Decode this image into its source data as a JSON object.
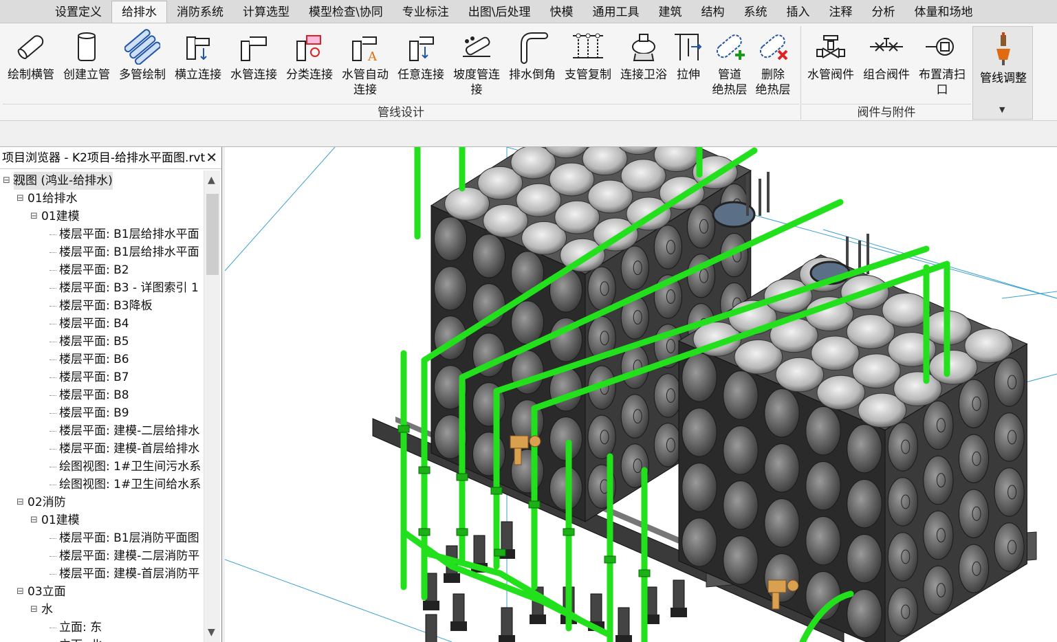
{
  "ribbon": {
    "tabs": [
      "设置定义",
      "给排水",
      "消防系统",
      "计算选型",
      "模型检查\\协同",
      "专业标注",
      "出图\\后处理",
      "快模",
      "通用工具",
      "建筑",
      "结构",
      "系统",
      "插入",
      "注释",
      "分析",
      "体量和场地"
    ],
    "active_tab": "给排水",
    "pipeline_design": {
      "title": "管线设计",
      "buttons": [
        {
          "label": "绘制横管",
          "icon": "horizontal-pipe-icon"
        },
        {
          "label": "创建立管",
          "icon": "vertical-pipe-icon"
        },
        {
          "label": "多管绘制",
          "icon": "multi-pipe-icon"
        },
        {
          "label": "横立连接",
          "icon": "horizontal-vertical-connect-icon"
        },
        {
          "label": "水管连接",
          "icon": "pipe-connect-icon"
        },
        {
          "label": "分类连接",
          "icon": "category-connect-icon"
        },
        {
          "label": "水管自动",
          "label2": "连接",
          "icon": "auto-connect-icon"
        },
        {
          "label": "任意连接",
          "icon": "any-connect-icon"
        },
        {
          "label": "坡度管连",
          "label2": "接",
          "icon": "slope-pipe-icon"
        },
        {
          "label": "排水倒角",
          "icon": "drain-chamfer-icon"
        },
        {
          "label": "支管复制",
          "icon": "branch-copy-icon"
        },
        {
          "label": "连接卫浴",
          "icon": "sanitary-connect-icon"
        },
        {
          "label": "拉伸",
          "icon": "stretch-icon"
        },
        {
          "label": "管道",
          "label2": "绝热层",
          "icon": "add-insulation-icon"
        },
        {
          "label": "删除",
          "label2": "绝热层",
          "icon": "delete-insulation-icon"
        }
      ]
    },
    "valves_accessories": {
      "title": "阀件与附件",
      "buttons": [
        {
          "label": "水管阀件",
          "icon": "valve-icon"
        },
        {
          "label": "组合阀件",
          "icon": "combined-valve-icon"
        },
        {
          "label": "布置清扫",
          "label2": "口",
          "icon": "cleanout-icon"
        }
      ]
    },
    "pipe_adjust": {
      "label": "管线调整",
      "icon": "pipe-adjust-icon"
    }
  },
  "browser": {
    "title": "项目浏览器 - K2项目-给排水平面图.rvt",
    "close_glyph": "✕",
    "tree": [
      {
        "text": "视图 (鸿业-给排水)",
        "level": 0,
        "twist": "⊟",
        "selected": true
      },
      {
        "text": "01给排水",
        "level": 1,
        "twist": "⊟"
      },
      {
        "text": "01建模",
        "level": 2,
        "twist": "⊟"
      },
      {
        "text": "楼层平面: B1层给排水平面",
        "level": 3
      },
      {
        "text": "楼层平面: B1层给排水平面",
        "level": 3
      },
      {
        "text": "楼层平面: B2",
        "level": 3
      },
      {
        "text": "楼层平面: B3 - 详图索引 1",
        "level": 3
      },
      {
        "text": "楼层平面: B3降板",
        "level": 3
      },
      {
        "text": "楼层平面: B4",
        "level": 3
      },
      {
        "text": "楼层平面: B5",
        "level": 3
      },
      {
        "text": "楼层平面: B6",
        "level": 3
      },
      {
        "text": "楼层平面: B7",
        "level": 3
      },
      {
        "text": "楼层平面: B8",
        "level": 3
      },
      {
        "text": "楼层平面: B9",
        "level": 3
      },
      {
        "text": "楼层平面: 建模-二层给排水",
        "level": 3
      },
      {
        "text": "楼层平面: 建模-首层给排水",
        "level": 3
      },
      {
        "text": "绘图视图: 1#卫生间污水系",
        "level": 3
      },
      {
        "text": "绘图视图: 1#卫生间给水系",
        "level": 3
      },
      {
        "text": "02消防",
        "level": 1,
        "twist": "⊟"
      },
      {
        "text": "01建模",
        "level": 2,
        "twist": "⊟"
      },
      {
        "text": "楼层平面: B1层消防平面图",
        "level": 3
      },
      {
        "text": "楼层平面: 建模-二层消防平",
        "level": 3
      },
      {
        "text": "楼层平面: 建模-首层消防平",
        "level": 3
      },
      {
        "text": "03立面",
        "level": 1,
        "twist": "⊟"
      },
      {
        "text": "水",
        "level": 2,
        "twist": "⊟"
      },
      {
        "text": "立面: 东",
        "level": 3
      },
      {
        "text": "立面: 北",
        "level": 3
      }
    ]
  },
  "colors": {
    "pipe_green": "#22e01c",
    "tank_dark": "#2a2a2a",
    "tank_panel": "#7d7d7d",
    "valve_orange": "#d9a050",
    "hatch_blue": "#5b6f86",
    "grid_line": "#3aa0d0"
  }
}
